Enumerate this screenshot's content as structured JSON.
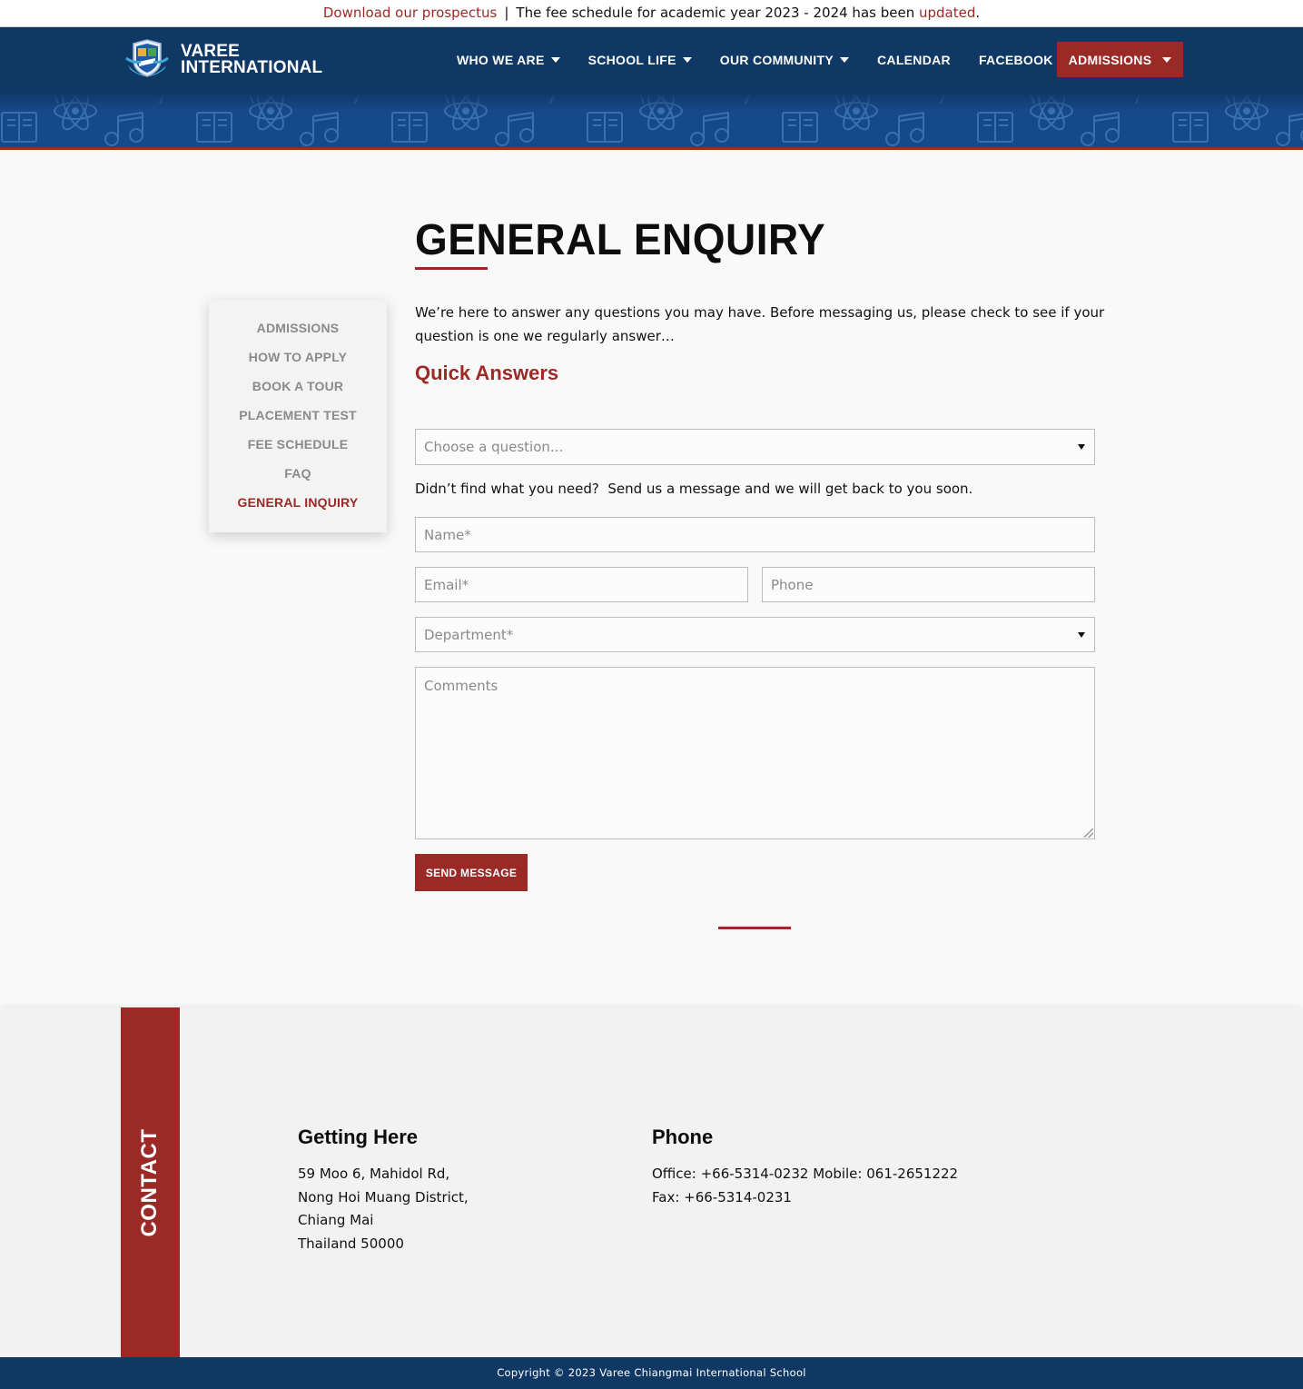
{
  "announcement": {
    "link1": "Download our prospectus",
    "separator": "|",
    "text": "The fee schedule for academic year 2023 - 2024 has been",
    "link2": "updated",
    "end": "."
  },
  "brand": {
    "line1": "VAREE",
    "line2": "INTERNATIONAL",
    "color_primary": "#103865",
    "color_accent": "#9b2a27"
  },
  "nav": {
    "items": [
      {
        "label": "WHO WE ARE",
        "dropdown": true
      },
      {
        "label": "SCHOOL LIFE",
        "dropdown": true
      },
      {
        "label": "OUR COMMUNITY",
        "dropdown": true
      },
      {
        "label": "CALENDAR",
        "dropdown": false
      },
      {
        "label": "FACEBOOK PAGE",
        "dropdown": false
      }
    ],
    "cta": "ADMISSIONS"
  },
  "page": {
    "title": "GENERAL ENQUIRY",
    "intro": "We’re here to answer any questions you may have. Before messaging us, please check to see if your question is one we regularly answer…",
    "subhead": "Quick Answers"
  },
  "sidemenu": {
    "items": [
      {
        "label": "ADMISSIONS",
        "active": false
      },
      {
        "label": "HOW TO APPLY",
        "active": false
      },
      {
        "label": "BOOK A TOUR",
        "active": false
      },
      {
        "label": "PLACEMENT TEST",
        "active": false
      },
      {
        "label": "FEE SCHEDULE",
        "active": false
      },
      {
        "label": "FAQ",
        "active": false
      },
      {
        "label": "GENERAL INQUIRY",
        "active": true
      }
    ]
  },
  "form": {
    "question_select": "Choose a question...",
    "hint": "Didn’t find what you need?  Send us a message and we will get back to you soon.",
    "name_placeholder": "Name*",
    "email_placeholder": "Email*",
    "phone_placeholder": "Phone",
    "department_select": "Department*",
    "comments_placeholder": "Comments",
    "submit": "SEND MESSAGE"
  },
  "contact": {
    "tab": "CONTACT",
    "getting_here": {
      "heading": "Getting Here",
      "lines": [
        "59 Moo 6, Mahidol Rd,",
        "Nong Hoi Muang District,",
        "Chiang Mai",
        "Thailand 50000"
      ]
    },
    "phone": {
      "heading": "Phone",
      "lines": [
        "Office: +66-5314-0232 Mobile: 061-2651222",
        "Fax: +66-5314-0231"
      ]
    }
  },
  "footer": {
    "copyright": "Copyright © 2023 Varee Chiangmai International School"
  },
  "icons": [
    "shield-logo-icon",
    "chevron-down-icon",
    "book-icon",
    "atom-icon",
    "music-note-icon",
    "resize-grip-icon"
  ]
}
